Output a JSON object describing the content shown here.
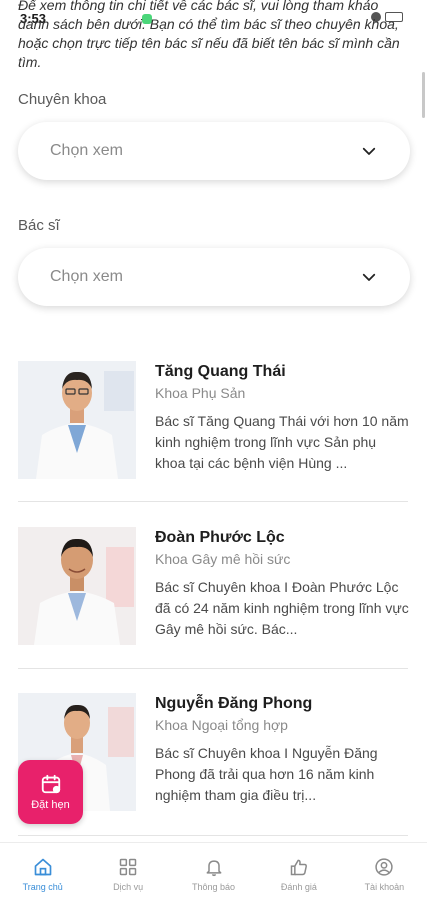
{
  "status_bar": {
    "time": "3:53"
  },
  "intro_text": "Để xem thông tin chi tiết về các bác sĩ, vui lòng tham khảo danh sách bên dưới. Bạn có thể tìm bác sĩ theo chuyên khoa, hoặc chọn trực tiếp tên bác sĩ nếu đã biết tên bác sĩ mình cần tìm.",
  "filters": {
    "specialty": {
      "label": "Chuyên khoa",
      "placeholder": "Chọn xem"
    },
    "doctor": {
      "label": "Bác sĩ",
      "placeholder": "Chọn xem"
    }
  },
  "doctors": [
    {
      "name": "Tăng Quang Thái",
      "department": "Khoa Phụ Sản",
      "description": "Bác sĩ Tăng Quang Thái với hơn 10 năm kinh nghiệm trong lĩnh vực Sản phụ khoa tại các bệnh viện Hùng ..."
    },
    {
      "name": "Đoàn Phước Lộc",
      "department": "Khoa Gây mê hồi sức",
      "description": "Bác sĩ Chuyên khoa I Đoàn Phước Lộc đã có 24 năm kinh nghiệm trong lĩnh vực Gây mê hồi sức. Bác..."
    },
    {
      "name": "Nguyễn Đăng Phong",
      "department": "Khoa Ngoại tổng hợp",
      "description": "Bác sĩ Chuyên khoa I Nguyễn Đăng Phong đã trải qua hơn 16 năm kinh nghiệm tham gia điều trị..."
    }
  ],
  "fab": {
    "label": "Đặt hẹn",
    "icon": "calendar-icon",
    "color": "#e8216b"
  },
  "bottom_nav": [
    {
      "label": "Trang chủ",
      "icon": "home-icon",
      "active": true
    },
    {
      "label": "Dịch vụ",
      "icon": "grid-icon",
      "active": false
    },
    {
      "label": "Thông báo",
      "icon": "bell-icon",
      "active": false
    },
    {
      "label": "Đánh giá",
      "icon": "thumbs-up-icon",
      "active": false
    },
    {
      "label": "Tài khoản",
      "icon": "user-icon",
      "active": false
    }
  ],
  "colors": {
    "accent": "#3a8ed8",
    "brand": "#e8216b"
  }
}
